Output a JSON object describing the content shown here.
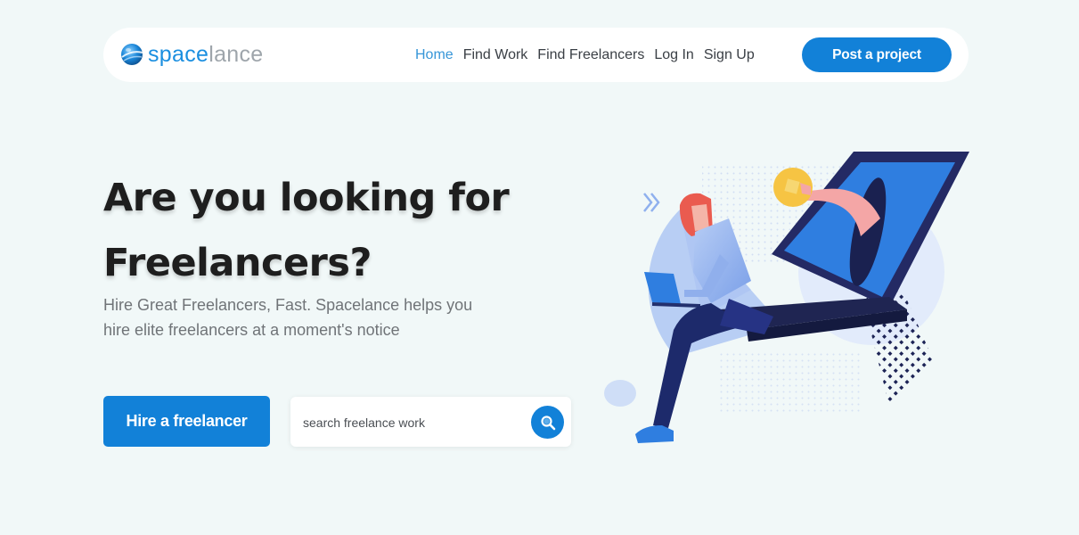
{
  "brand": {
    "name_part1": "space",
    "name_part2": "lance",
    "logo_icon": "globe-icon"
  },
  "nav": {
    "links": [
      {
        "label": "Home",
        "active": true
      },
      {
        "label": "Find Work"
      },
      {
        "label": "Find Freelancers"
      },
      {
        "label": "Log In"
      },
      {
        "label": "Sign Up"
      }
    ],
    "cta_label": "Post a project"
  },
  "hero": {
    "title_line1": "Are you looking for",
    "title_line2": "Freelancers?",
    "subtitle": "Hire Great Freelancers, Fast. Spacelance helps you hire elite freelancers at a moment's notice",
    "hire_button_label": "Hire a freelancer",
    "search": {
      "placeholder": "search freelance work",
      "value": "",
      "icon": "search-icon"
    }
  },
  "illustration": {
    "subject": "hero-illustration"
  },
  "colors": {
    "primary": "#1281d8",
    "background": "#f1f8f8",
    "nav_active": "#3796d8",
    "heading": "#1e1e1e",
    "body_text": "#707478"
  }
}
